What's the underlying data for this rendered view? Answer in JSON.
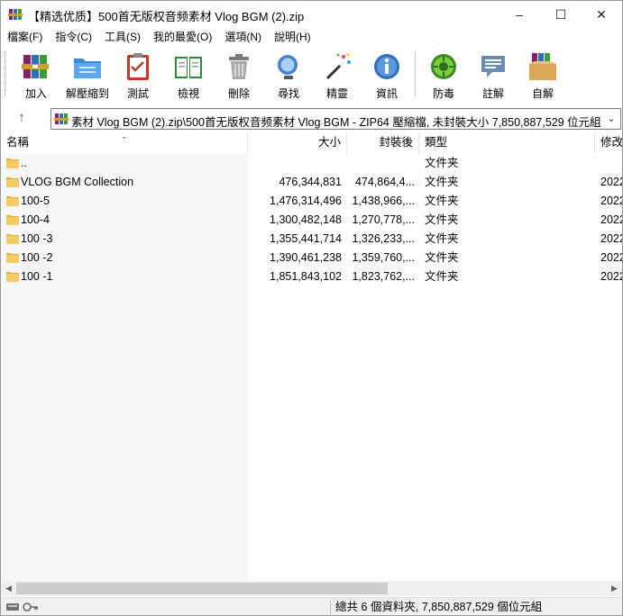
{
  "window": {
    "title": "【精选优质】500首无版权音频素材 Vlog BGM (2).zip",
    "controls": {
      "minimize": "–",
      "maximize": "☐",
      "close": "✕"
    }
  },
  "menu": [
    {
      "label": "檔案(F)"
    },
    {
      "label": "指令(C)"
    },
    {
      "label": "工具(S)"
    },
    {
      "label": "我的最愛(O)"
    },
    {
      "label": "選項(N)"
    },
    {
      "label": "說明(H)"
    }
  ],
  "toolbar": [
    {
      "label": "加入",
      "icon": "books-add-icon"
    },
    {
      "label": "解壓縮到",
      "icon": "folder-extract-icon"
    },
    {
      "label": "測試",
      "icon": "clipboard-test-icon"
    },
    {
      "label": "檢視",
      "icon": "book-view-icon"
    },
    {
      "label": "刪除",
      "icon": "trash-delete-icon"
    },
    {
      "label": "尋找",
      "icon": "magnifier-find-icon"
    },
    {
      "label": "精靈",
      "icon": "wizard-wand-icon"
    },
    {
      "label": "資訊",
      "icon": "info-icon"
    },
    {
      "label": "防毒",
      "icon": "virus-scan-icon"
    },
    {
      "label": "註解",
      "icon": "comment-icon"
    },
    {
      "label": "自解",
      "icon": "sfx-box-icon"
    }
  ],
  "address": {
    "up_glyph": "↑",
    "path": "素材 Vlog BGM (2).zip\\500首无版权音频素材 Vlog BGM - ZIP64 壓縮檔, 未封裝大小 7,850,887,529 位元組",
    "dropdown_glyph": "⌄"
  },
  "columns": {
    "name": "名稱",
    "size": "大小",
    "packed": "封裝後",
    "type": "類型",
    "modified": "修改"
  },
  "files": [
    {
      "name": "..",
      "size": "",
      "packed": "",
      "type": "文件夹",
      "modified": ""
    },
    {
      "name": "VLOG BGM Collection",
      "size": "476,344,831",
      "packed": "474,864,4...",
      "type": "文件夹",
      "modified": "2022"
    },
    {
      "name": "100-5",
      "size": "1,476,314,496",
      "packed": "1,438,966,...",
      "type": "文件夹",
      "modified": "2022"
    },
    {
      "name": "100-4",
      "size": "1,300,482,148",
      "packed": "1,270,778,...",
      "type": "文件夹",
      "modified": "2022"
    },
    {
      "name": "100 -3",
      "size": "1,355,441,714",
      "packed": "1,326,233,...",
      "type": "文件夹",
      "modified": "2022"
    },
    {
      "name": "100 -2",
      "size": "1,390,461,238",
      "packed": "1,359,760,...",
      "type": "文件夹",
      "modified": "2022"
    },
    {
      "name": "100 -1",
      "size": "1,851,843,102",
      "packed": "1,823,762,...",
      "type": "文件夹",
      "modified": "2022"
    }
  ],
  "status": {
    "summary": "總共 6 個資料夾, 7,850,887,529 個位元組"
  },
  "colors": {
    "folder": "#f4cc66",
    "folder_dark": "#e0b040",
    "column_shade": "#f7f7f7"
  }
}
